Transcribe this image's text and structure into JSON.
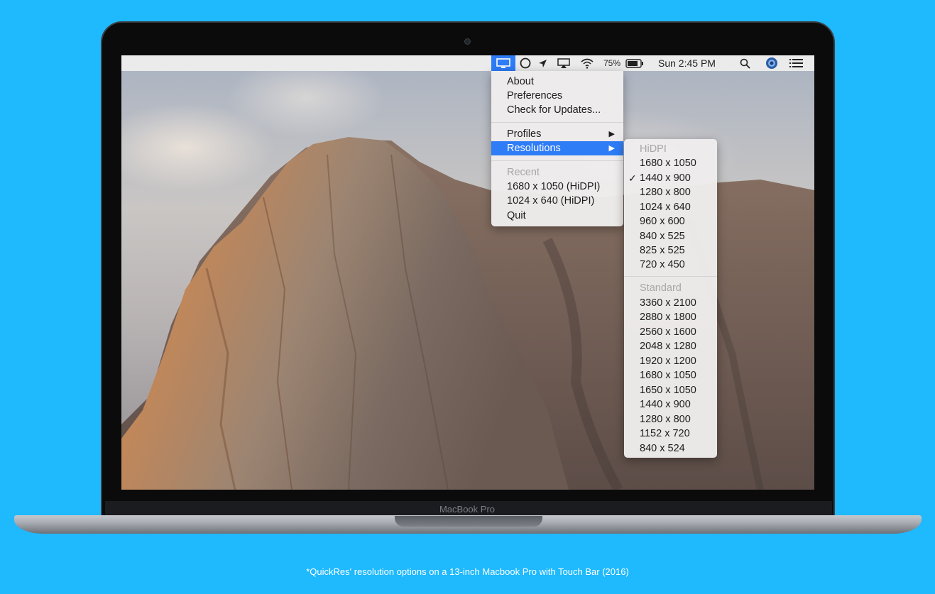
{
  "menubar": {
    "battery_percent": "75%",
    "clock": "Sun 2:45 PM",
    "icons": [
      "display-icon",
      "circle-icon",
      "location-arrow-icon",
      "airplay-icon",
      "wifi-icon",
      "battery-icon",
      "search-icon",
      "user-avatar-icon",
      "list-icon"
    ]
  },
  "main_menu": {
    "about": "About",
    "preferences": "Preferences",
    "check_updates": "Check for Updates...",
    "profiles": "Profiles",
    "resolutions": "Resolutions",
    "recent_header": "Recent",
    "recent_items": [
      "1680 x 1050 (HiDPI)",
      "1024 x 640 (HiDPI)"
    ],
    "quit": "Quit"
  },
  "submenu": {
    "hidpi_header": "HiDPI",
    "hidpi_items": [
      "1680 x 1050",
      "1440 x 900",
      "1280 x 800",
      "1024 x 640",
      "960 x 600",
      "840 x 525",
      "825 x 525",
      "720 x 450"
    ],
    "checked_item": "1440 x 900",
    "standard_header": "Standard",
    "standard_items": [
      "3360 x 2100",
      "2880 x 1800",
      "2560 x 1600",
      "2048 x 1280",
      "1920 x 1200",
      "1680 x 1050",
      "1650 x 1050",
      "1440 x 900",
      "1280 x 800",
      "1152 x 720",
      "840 x 524"
    ]
  },
  "device_label": "MacBook Pro",
  "caption": "*QuickRes' resolution options on a 13-inch Macbook Pro with Touch Bar (2016)",
  "colors": {
    "background": "#1fb9fd",
    "menu_highlight": "#2e7cf6"
  }
}
